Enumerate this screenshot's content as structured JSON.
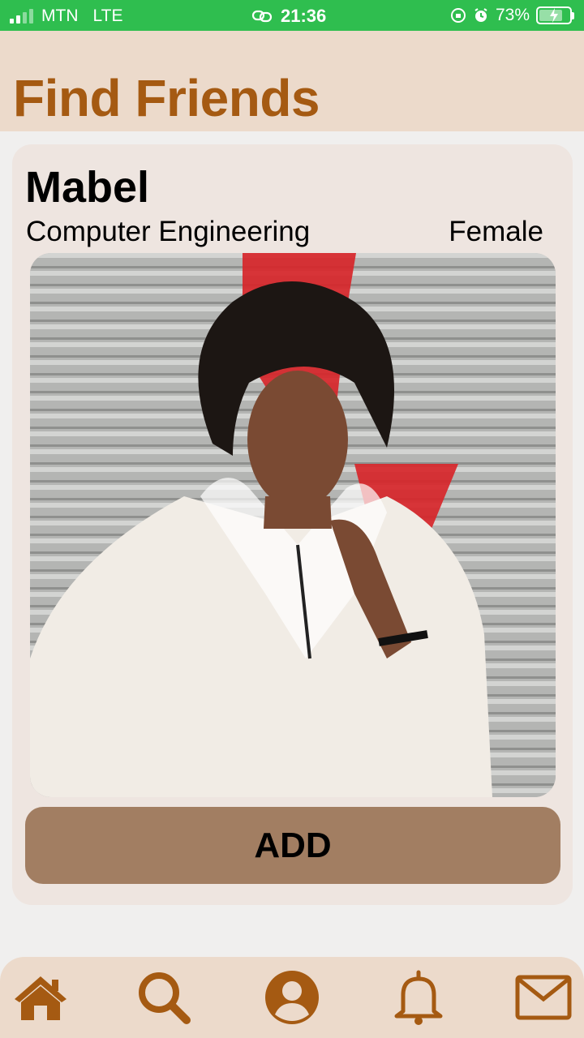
{
  "status_bar": {
    "carrier": "MTN",
    "network": "LTE",
    "time": "21:36",
    "battery": "73%"
  },
  "header": {
    "title": "Find Friends"
  },
  "profile": {
    "name": "Mabel",
    "major": "Computer Engineering",
    "gender": "Female",
    "photo_icon": "profile-photo"
  },
  "actions": {
    "add_label": "ADD"
  },
  "nav": {
    "items": [
      {
        "icon": "home-icon"
      },
      {
        "icon": "search-icon"
      },
      {
        "icon": "profile-icon"
      },
      {
        "icon": "bell-icon"
      },
      {
        "icon": "mail-icon"
      }
    ]
  },
  "colors": {
    "status_bar": "#2fbe4f",
    "header_bg": "#ecdacb",
    "title": "#a55a12",
    "card_bg": "#eee5e0",
    "button_bg": "#a27e62",
    "icon": "#a55a12"
  }
}
